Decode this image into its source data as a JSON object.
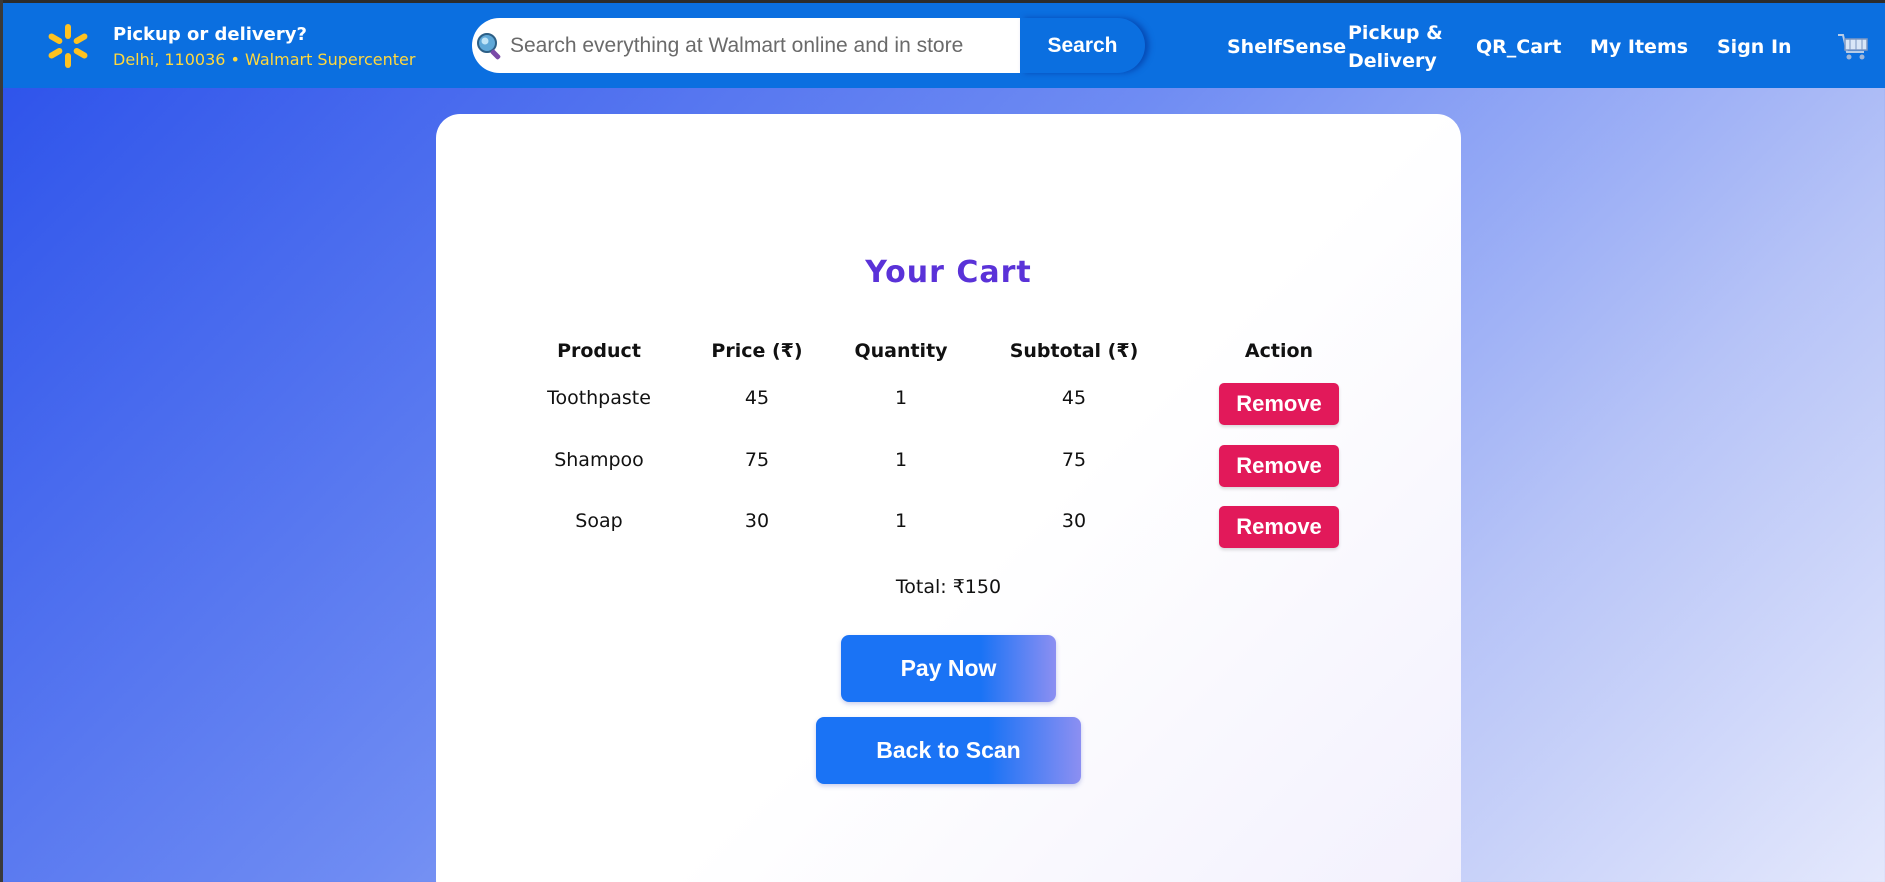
{
  "header": {
    "location_title": "Pickup or delivery?",
    "location_sub": "Delhi, 110036 • Walmart Supercenter",
    "search_placeholder": "Search everything at Walmart online and in store",
    "search_button": "Search",
    "nav": {
      "shelfsense": "ShelfSense",
      "pickup_line1": "Pickup &",
      "pickup_line2": "Delivery",
      "qr_cart": "QR_Cart",
      "my_items": "My Items",
      "sign_in": "Sign In"
    },
    "icons": {
      "logo": "walmart-spark-icon",
      "search": "search-icon",
      "cart": "shopping-cart-icon"
    }
  },
  "cart": {
    "title": "Your Cart",
    "columns": [
      "Product",
      "Price (₹)",
      "Quantity",
      "Subtotal (₹)",
      "Action"
    ],
    "rows": [
      {
        "product": "Toothpaste",
        "price": "45",
        "quantity": "1",
        "subtotal": "45",
        "action": "Remove"
      },
      {
        "product": "Shampoo",
        "price": "75",
        "quantity": "1",
        "subtotal": "75",
        "action": "Remove"
      },
      {
        "product": "Soap",
        "price": "30",
        "quantity": "1",
        "subtotal": "30",
        "action": "Remove"
      }
    ],
    "total": "Total: ₹150",
    "pay_now": "Pay Now",
    "back_to_scan": "Back to Scan"
  },
  "colors": {
    "header_bg": "#0b6fe0",
    "brand_yellow": "#ffc220",
    "title_purple": "#5a32d8",
    "remove_red": "#e2195a",
    "primary_blue": "#1a73f5"
  }
}
